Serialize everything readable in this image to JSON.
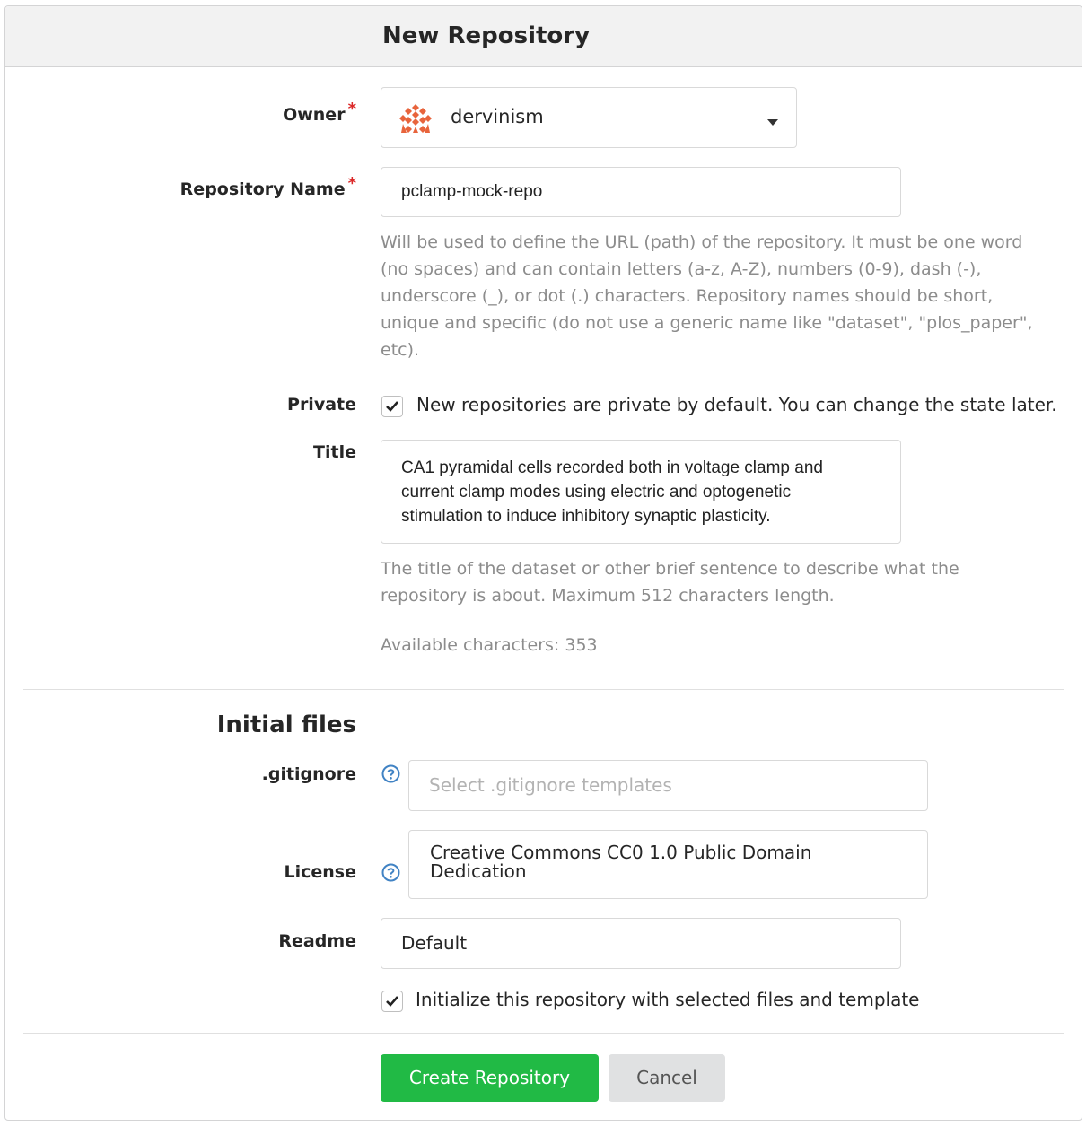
{
  "header": {
    "title": "New Repository"
  },
  "owner": {
    "label": "Owner",
    "required_mark": "*",
    "value": "dervinism"
  },
  "repo_name": {
    "label": "Repository Name",
    "required_mark": "*",
    "value": "pclamp-mock-repo",
    "help_lines": [
      "Will be used to define the URL (path) of the repository. It must be one word",
      "(no spaces) and can contain letters (a-z, A-Z), numbers (0-9), dash (-),",
      "underscore (_), or dot (.) characters. Repository names should be short,",
      "unique and specific (do not use a generic name like \"dataset\", \"plos_paper\",",
      "etc)."
    ]
  },
  "private": {
    "label": "Private",
    "checked": true,
    "text": "New repositories are private by default. You can change the state later."
  },
  "title_field": {
    "label": "Title",
    "value_lines": [
      "CA1 pyramidal cells recorded both in voltage clamp and",
      "current clamp modes using electric and optogenetic",
      "stimulation to induce inhibitory synaptic plasticity."
    ],
    "help_lines": [
      "The title of the dataset or other brief sentence to describe what the",
      "repository is about. Maximum 512 characters length."
    ],
    "available": "Available characters: 353"
  },
  "initial_files": {
    "heading": "Initial files",
    "gitignore": {
      "label": ".gitignore",
      "placeholder": "Select .gitignore templates"
    },
    "license": {
      "label": "License",
      "value_lines": [
        "Creative Commons CC0 1.0 Public Domain",
        "Dedication"
      ]
    },
    "readme": {
      "label": "Readme",
      "value": "Default"
    },
    "init": {
      "checked": true,
      "text": "Initialize this repository with selected files and template"
    }
  },
  "actions": {
    "create_label": "Create Repository",
    "cancel_label": "Cancel"
  },
  "colors": {
    "primary": "#21ba45",
    "required": "#db2828",
    "help_icon": "#4183c4",
    "cancel_bg": "#e0e1e2",
    "avatar": "#e8643c"
  }
}
